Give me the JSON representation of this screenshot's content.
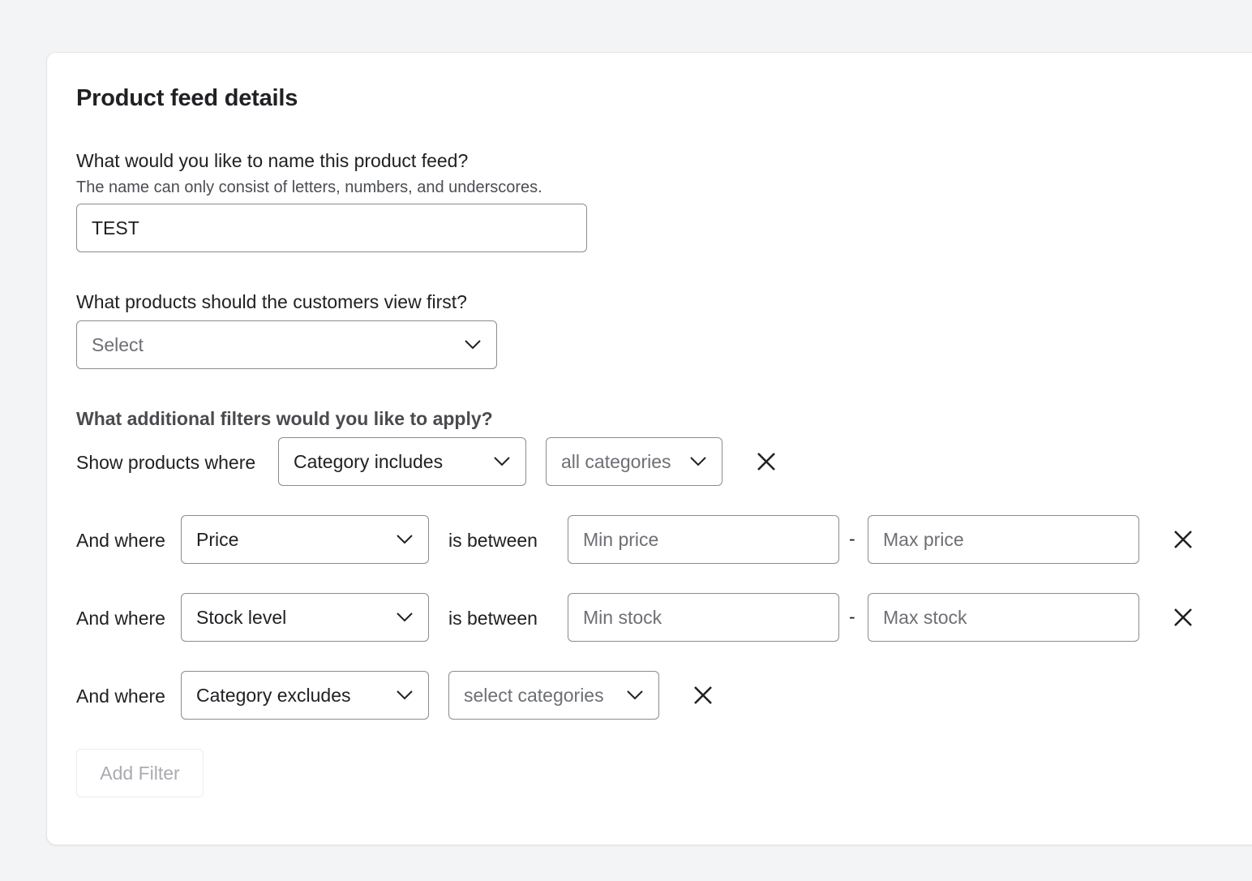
{
  "card": {
    "title": "Product feed details"
  },
  "name_section": {
    "question": "What would you like to name this product feed?",
    "help": "The name can only consist of letters, numbers, and underscores.",
    "value": "TEST"
  },
  "view_first": {
    "question": "What products should the customers view first?",
    "placeholder": "Select"
  },
  "filters": {
    "heading": "What additional filters would you like to apply?",
    "row1": {
      "label": "Show products where",
      "field": "Category includes",
      "value": "all categories"
    },
    "row2": {
      "label": "And where",
      "field": "Price",
      "operator": "is between",
      "min_placeholder": "Min price",
      "separator": "-",
      "max_placeholder": "Max price"
    },
    "row3": {
      "label": "And where",
      "field": "Stock level",
      "operator": "is between",
      "min_placeholder": "Min stock",
      "separator": "-",
      "max_placeholder": "Max stock"
    },
    "row4": {
      "label": "And where",
      "field": "Category excludes",
      "value": "select categories"
    },
    "add_filter_label": "Add Filter"
  },
  "icons": {
    "chevron": "chevron-down-icon",
    "remove": "close-icon"
  }
}
